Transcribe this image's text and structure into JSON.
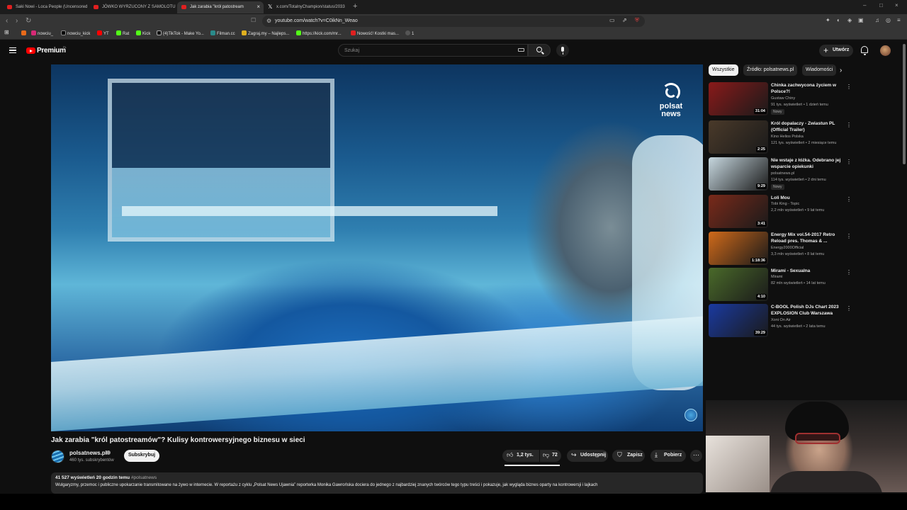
{
  "browser": {
    "tabs": [
      {
        "label": "Saki Nowi - Loca People (Uncensored",
        "icon": "youtube-icon",
        "active": false
      },
      {
        "label": "JÓWKO WYRZUCONY Z SAMOLOTU",
        "icon": "youtube-icon",
        "active": false
      },
      {
        "label": "Jak zarabia \"król patostream",
        "icon": "youtube-icon",
        "active": true
      },
      {
        "label": "x.com/TotalnyChampion/status/2033",
        "icon": "x-icon",
        "active": false
      }
    ],
    "url": "youtube.com/watch?v=C0ikNn_Weao",
    "bookmarks": [
      "nowciu_",
      "nowciu_kick",
      "YT",
      "Rat",
      "Kick",
      "(4)TikTok - Make Yo...",
      "Filman.cc",
      "Zagraj.my – Najleps...",
      "https://kick.com/mr...",
      "Nowość! Kostki mas...",
      "1"
    ]
  },
  "header": {
    "logo_text": "Premium",
    "logo_country": "PL",
    "search_placeholder": "Szukaj",
    "create_label": "Utwórz"
  },
  "player": {
    "watermark_line1": "polsat",
    "watermark_line2": "news"
  },
  "video": {
    "title": "Jak zarabia \"król patostreamów\"? Kulisy kontrowersyjnego biznesu w sieci",
    "channel_name": "polsatnews.pl",
    "subscribers": "460 tys. subskrybentów",
    "subscribe_label": "Subskrybuj",
    "likes": "1,2 tys.",
    "dislikes": "72",
    "share_label": "Udostępnij",
    "save_label": "Zapisz",
    "download_label": "Pobierz",
    "views_date": "41 527 wyświetleń  20 godzin temu",
    "hashtag": "#polsatnews",
    "description": "Wulgaryzmy, przemoc i publiczne upokarzanie transmitowane na żywo w internecie. W reportażu z cyklu „Polsat News Ujawnia” reporterka Monika Gawrońska dociera do jednego z najbardziej znanych twórców tego typu treści i pokazuje, jak wygląda biznes oparty na kontrowersji i lajkach"
  },
  "sidebar": {
    "chips": [
      "Wszystkie",
      "Źródło: polsatnews.pl",
      "Wiadomości"
    ],
    "recommendations": [
      {
        "title": "Chinka zachwycona życiem w Polsce?!",
        "channel": "Gustaw Chiny",
        "views": "91 tys. wyświetleń • 1 dzień temu",
        "badge": "Nowy",
        "duration": "31:04",
        "thumb_color": "#8a1a1a"
      },
      {
        "title": "Król dopalaczy - Zwiastun PL (Official Trailer)",
        "channel": "Kino Helios Polska",
        "views": "121 tys. wyświetleń • 2 miesiące temu",
        "badge": "",
        "duration": "2:25",
        "thumb_color": "#4a3a2a"
      },
      {
        "title": "Nie wstaje z łóżka. Odebrano jej wsparcie opiekunki",
        "channel": "polsatnews.pl",
        "views": "114 tys. wyświetleń • 2 dni temu",
        "badge": "Nowy",
        "duration": "9:29",
        "thumb_color": "#c7d8e0"
      },
      {
        "title": "Loli Mou",
        "channel": "Tobi King - Topic",
        "views": "2,2 mln wyświetleń • 9 lat temu",
        "badge": "",
        "duration": "3:41",
        "thumb_color": "#7a2a1a"
      },
      {
        "title": "Energy Mix vol.54-2017 Retro Reload pres. Thomas & ...",
        "channel": "Energy2000Official",
        "views": "3,3 mln wyświetleń • 8 lat temu",
        "badge": "",
        "duration": "1:18:36",
        "thumb_color": "#d06a1a"
      },
      {
        "title": "Mirami - Sexualna",
        "channel": "Mirami",
        "views": "82 mln wyświetleń • 14 lat temu",
        "badge": "",
        "duration": "4:10",
        "thumb_color": "#4a6a2a"
      },
      {
        "title": "C-BOOL Polish DJs Chart 2023 EXPLOSION Club Warszawa",
        "channel": "Xoni On Air",
        "views": "44 tys. wyświetleń • 2 lata temu",
        "badge": "",
        "duration": "39:29",
        "thumb_color": "#1a3aa0"
      }
    ]
  }
}
